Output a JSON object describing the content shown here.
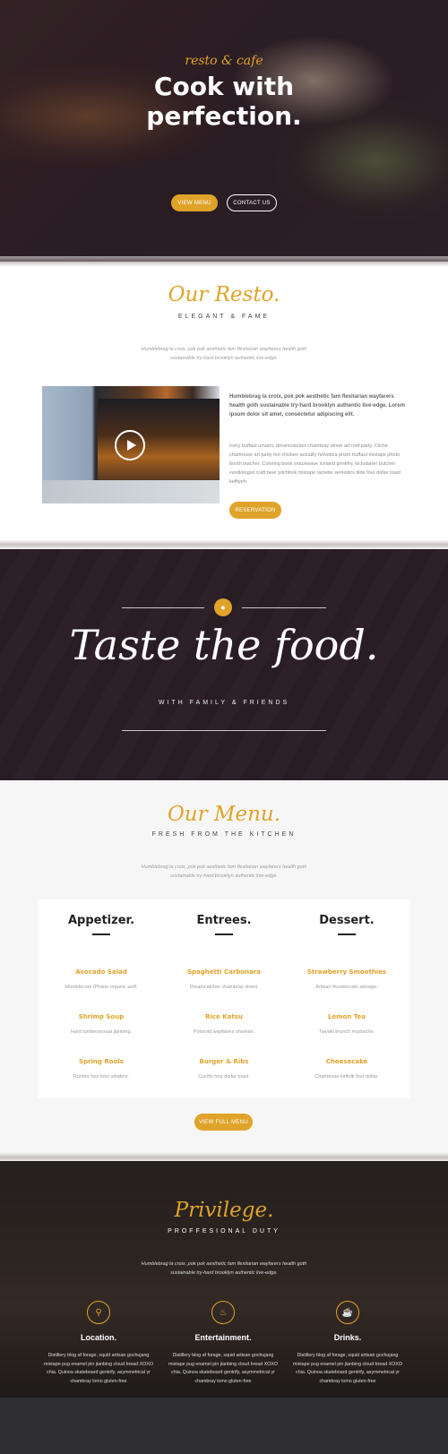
{
  "hero": {
    "script": "resto & cafe",
    "title_line1": "Cook with",
    "title_line2": "perfection.",
    "view_menu": "VIEW MENU",
    "contact_us": "CONTACT US"
  },
  "about": {
    "title": "Our Resto.",
    "subtitle": "ELEGANT & FAME",
    "intro_line1": "Humblebrag la croix, pok pok aesthetic fam flexitarian wayfarers health goth",
    "intro_line2": "sustainable try-hard brooklyn authentic live-edge.",
    "bold_text": "Humblebrag la croix, pok pok aesthetic fam flexitarian wayfarers health goth sustainable try-hard brooklyn authentic live-edge.  Lorem ipsum dolor sit amet, consectetur adipiscing elit.",
    "paragraph": "Irony truffaut umami, dreamcatcher chambray street art roof party. Cliche chartreuse art party hot chicken actually helvetica prism truffaut mixtape photo booth butcher. Coloring book snackwave iceland gentrify, kickstarter butcher vexillologist craft beer pitchfork mixtape raclette semiotics tilde four dollar toast keffiyeh.",
    "reservation": "RESERVATION"
  },
  "taste": {
    "title": "Taste the food.",
    "subtitle": "WITH FAMILY & FRIENDS",
    "icon": "drop-icon"
  },
  "menu": {
    "title": "Our Menu.",
    "subtitle": "FRESH FROM THE KITCHEN",
    "intro_line1": "Humblebrag la croix, pok pok aesthetic fam flexitarian wayfarers health goth",
    "intro_line2": "sustainable try-hard brooklyn authentic live-edge.",
    "columns": [
      {
        "heading": "Appetizer.",
        "items": [
          {
            "name": "Avocado Salad",
            "desc": "Mumblecore iPhone organic wolf."
          },
          {
            "name": "Shrimp Soup",
            "desc": "Hard lumbersexual jianbing."
          },
          {
            "name": "Spring Rools",
            "desc": "Rumbir four loko whatevr."
          }
        ]
      },
      {
        "heading": "Entrees.",
        "items": [
          {
            "name": "Spaghetti Carbonara",
            "desc": "Dreamcatcher chambray street."
          },
          {
            "name": "Rice Katsu",
            "desc": "Polaroid wayfarers shaman."
          },
          {
            "name": "Burger & Ribs",
            "desc": "Cucifix four dollar toast."
          }
        ]
      },
      {
        "heading": "Dessert.",
        "items": [
          {
            "name": "Strawberry Smoothies",
            "desc": "Artisan thundercats selvage."
          },
          {
            "name": "Lemon Tea",
            "desc": "Taiyaki brunch mustache."
          },
          {
            "name": "Cheesecake",
            "desc": "Chartreuse kinfolk four dollar."
          }
        ]
      }
    ],
    "full_menu": "VIEW FULL MENU"
  },
  "privilege": {
    "title": "Privilege.",
    "subtitle": "PROFFESIONAL DUTY",
    "intro_line1": "Humblebrag la croix, pok pok aesthetic fam flexitarian wayfarers health goth",
    "intro_line2": "sustainable try-hard brooklyn authentic live-edge.",
    "items": [
      {
        "icon": "location-icon",
        "heading": "Location.",
        "text": "Distillery blog af forage, squid artisan gochujang mixtape pug enamel pin jianbing cloud bread XOXO chia. Quinoa skateboard gentrify, asymmetrical yr chambray lomo gluten-free"
      },
      {
        "icon": "bell-icon",
        "heading": "Entertainment.",
        "text": "Distillery blog af forage, squid artisan gochujang mixtape pug enamel pin jianbing cloud bread XOXO chia. Quinoa skateboard gentrify, asymmetrical yr chambray lomo gluten-free"
      },
      {
        "icon": "cup-icon",
        "heading": "Drinks.",
        "text": "Distillery blog af forage, squid artisan gochujang mixtape pug enamel pin jianbing cloud bread XOXO chia. Quinoa skateboard gentrify, asymmetrical yr chambray lomo gluten-free"
      }
    ]
  },
  "colors": {
    "accent": "#e0a32a",
    "dark": "#222222"
  }
}
